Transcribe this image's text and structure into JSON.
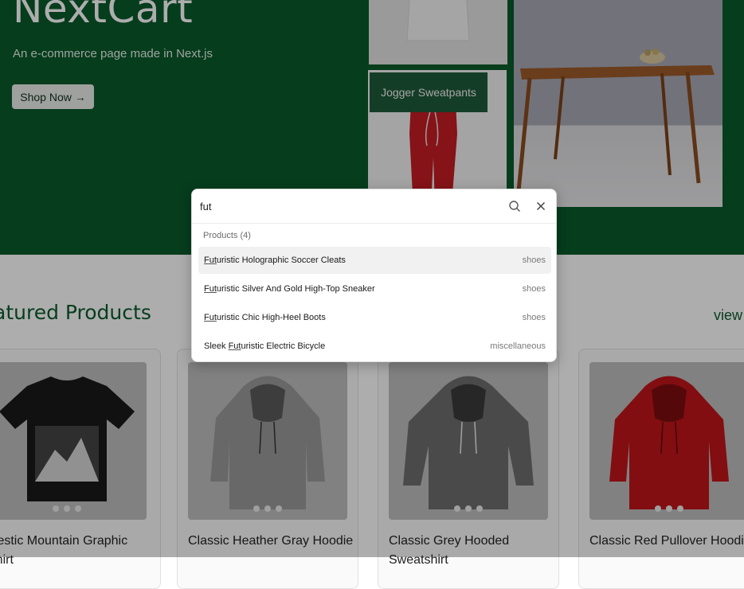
{
  "hero": {
    "title": "NextCart",
    "subtitle": "An e-commerce page made in Next.js",
    "shop_button": "Shop Now →",
    "tiles": [
      {
        "name": "shirt",
        "label": ""
      },
      {
        "name": "jogger",
        "label": "Jogger Sweatpants"
      },
      {
        "name": "table",
        "label": ""
      }
    ]
  },
  "featured": {
    "heading": "atured Products",
    "view_all": "view"
  },
  "products": [
    {
      "title": "ajestic Mountain Graphic Shirt",
      "color": "#1a1a1a"
    },
    {
      "title": "Classic Heather Gray Hoodie",
      "color": "#8a8a8a"
    },
    {
      "title": "Classic Grey Hooded Sweatshirt",
      "color": "#6a6a6a"
    },
    {
      "title": "Classic Red Pullover Hoodie",
      "color": "#c0161b"
    }
  ],
  "search": {
    "query": "fut",
    "group_heading": "Products (4)",
    "results": [
      {
        "pre": "",
        "match": "Fut",
        "post": "uristic Holographic Soccer Cleats",
        "category": "shoes"
      },
      {
        "pre": "",
        "match": "Fut",
        "post": "uristic Silver And Gold High-Top Sneaker",
        "category": "shoes"
      },
      {
        "pre": "",
        "match": "Fut",
        "post": "uristic Chic High-Heel Boots",
        "category": "shoes"
      },
      {
        "pre": "Sleek ",
        "match": "Fut",
        "post": "uristic Electric Bicycle",
        "category": "miscellaneous"
      }
    ]
  },
  "colors": {
    "brand_green": "#0a5a2c",
    "overlay": "rgba(0,0,0,0.32)"
  },
  "icons": [
    "search-icon",
    "close-icon",
    "carousel-dot-icon"
  ]
}
